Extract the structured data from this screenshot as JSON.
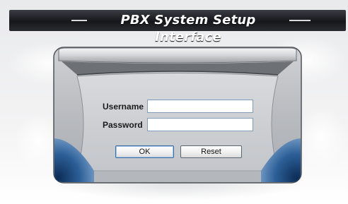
{
  "header": {
    "title": "PBX System Setup Interface"
  },
  "login": {
    "username_label": "Username",
    "username_value": "",
    "password_label": "Password",
    "password_value": "",
    "ok_label": "OK",
    "reset_label": "Reset"
  },
  "colors": {
    "title_bar": "#15171b",
    "panel_gray": "#b9bcc0",
    "accent_blue": "#1f4f86"
  }
}
